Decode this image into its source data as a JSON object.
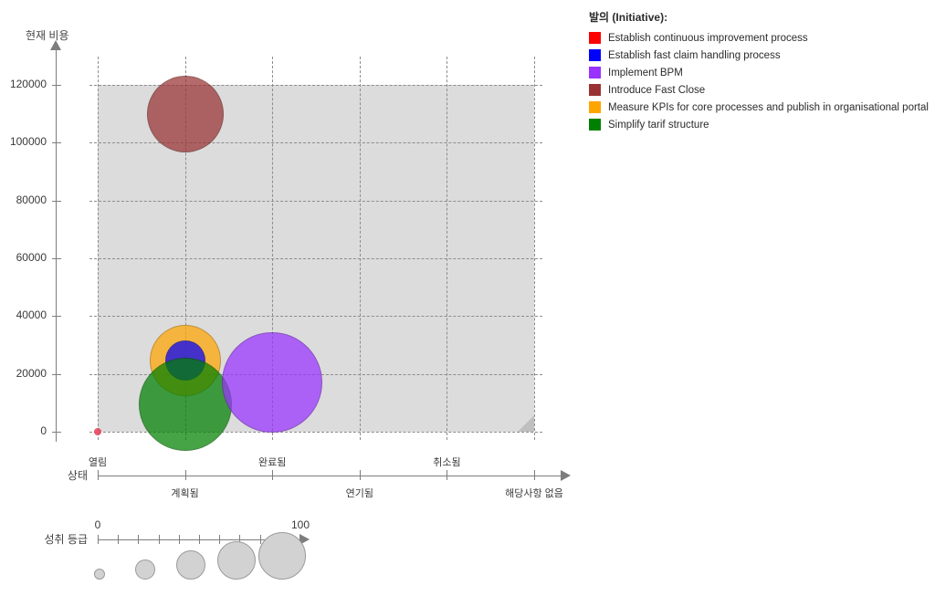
{
  "chart_data": {
    "type": "scatter",
    "title": "",
    "xlabel": "상태",
    "ylabel": "현재 비용",
    "size_label": "성취 등급",
    "grid": true,
    "legend_position": "right",
    "plot_bg": "#dcdcdc",
    "y_ticks": [
      "0",
      "20000",
      "40000",
      "60000",
      "80000",
      "100000",
      "120000"
    ],
    "y_values": [
      0,
      20000,
      40000,
      60000,
      80000,
      100000,
      120000
    ],
    "ylim": [
      0,
      120000
    ],
    "x_categories": [
      "열림",
      "계획됨",
      "완료됨",
      "연기됨",
      "취소됨",
      "해당사항 없음"
    ],
    "size_ticks": {
      "min_label": "0",
      "max_label": "100",
      "tick_count": 11
    },
    "size_legend_bubbles": [
      6,
      11,
      16,
      21,
      26
    ],
    "points": [
      {
        "name": "Establish continuous improvement process",
        "x_category": "열림",
        "y": 0,
        "size": 4,
        "color": "#e8405a"
      },
      {
        "name": "Introduce Fast Close",
        "x_category": "계획됨",
        "y": 110000,
        "size": 42,
        "color": "#993333"
      },
      {
        "name": "Measure KPIs for core processes and publish in organisational portal",
        "x_category": "계획됨",
        "y": 24500,
        "size": 39,
        "color": "#FFA500"
      },
      {
        "name": "Establish fast claim handling process",
        "x_category": "계획됨",
        "y": 24500,
        "size": 22,
        "color": "#0000FF"
      },
      {
        "name": "Simplify tarif structure",
        "x_category": "계획됨",
        "y": 9500,
        "size": 51,
        "color": "#008000"
      },
      {
        "name": "Implement BPM",
        "x_category": "완료됨",
        "y": 17000,
        "size": 55,
        "color": "#9933FF"
      }
    ]
  },
  "legend": {
    "title": "발의 (Initiative):",
    "items": [
      {
        "label": "Establish continuous improvement process",
        "color": "#FF0000"
      },
      {
        "label": "Establish fast claim handling process",
        "color": "#0000FF"
      },
      {
        "label": "Implement BPM",
        "color": "#9933FF"
      },
      {
        "label": "Introduce Fast Close",
        "color": "#993333"
      },
      {
        "label": "Measure KPIs for core processes and publish in organisational portal",
        "color": "#FFA500"
      },
      {
        "label": "Simplify tarif structure",
        "color": "#008000"
      }
    ]
  }
}
